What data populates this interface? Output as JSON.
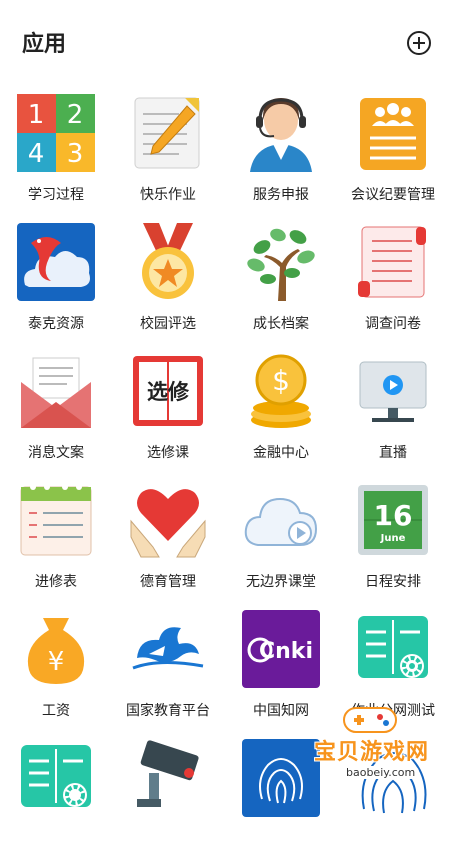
{
  "header": {
    "title": "应用"
  },
  "apps": [
    [
      "学习过程",
      "快乐作业",
      "服务申报",
      "会议纪要管理"
    ],
    [
      "泰克资源",
      "校园评选",
      "成长档案",
      "调查问卷"
    ],
    [
      "消息文案",
      "选修课",
      "金融中心",
      "直播"
    ],
    [
      "进修表",
      "德育管理",
      "无边界课堂",
      "日程安排"
    ],
    [
      "工资",
      "国家教育平台",
      "中国知网",
      "作业公网测试"
    ]
  ],
  "icon_text": {
    "digits": [
      "1",
      "2",
      "4",
      "3"
    ],
    "xuanxiu": "选修",
    "dollar": "$",
    "cal_day": "16",
    "cal_month": "June",
    "yen": "¥",
    "cnki": "Cnki"
  },
  "watermark": {
    "title": "宝贝游戏网",
    "url": "baobeiy.com"
  }
}
